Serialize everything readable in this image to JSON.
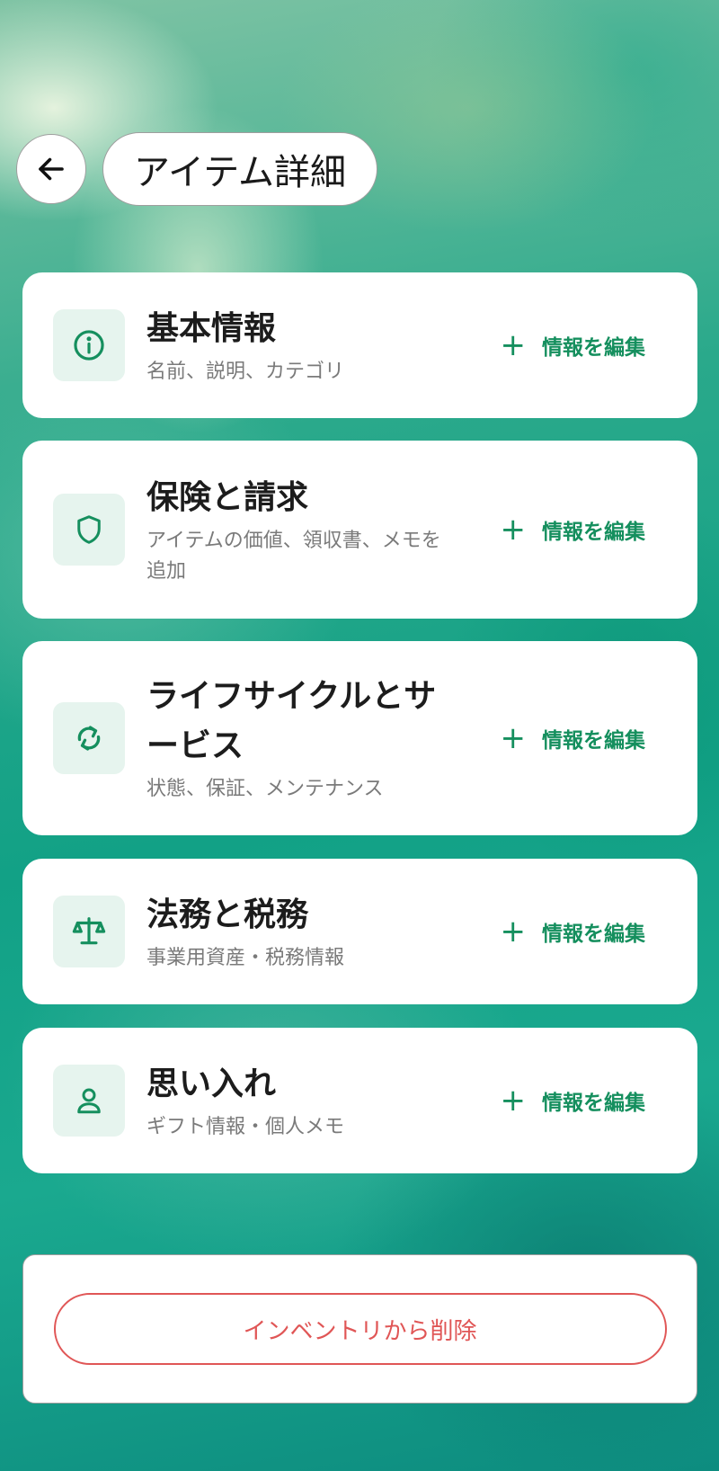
{
  "header": {
    "title": "アイテム詳細"
  },
  "sections": [
    {
      "title": "基本情報",
      "subtitle": "名前、説明、カテゴリ",
      "icon": "info-icon",
      "action": "情報を編集"
    },
    {
      "title": "保険と請求",
      "subtitle": "アイテムの価値、領収書、メモを追加",
      "icon": "shield-icon",
      "action": "情報を編集"
    },
    {
      "title": "ライフサイクルとサービス",
      "subtitle": "状態、保証、メンテナンス",
      "icon": "refresh-icon",
      "action": "情報を編集"
    },
    {
      "title": "法務と税務",
      "subtitle": "事業用資産・税務情報",
      "icon": "scale-icon",
      "action": "情報を編集"
    },
    {
      "title": "思い入れ",
      "subtitle": "ギフト情報・個人メモ",
      "icon": "person-icon",
      "action": "情報を編集"
    }
  ],
  "danger": {
    "delete_label": "インベントリから削除"
  },
  "colors": {
    "accent": "#158f5e",
    "icon_bg": "#e6f4ee",
    "danger": "#e05656"
  }
}
